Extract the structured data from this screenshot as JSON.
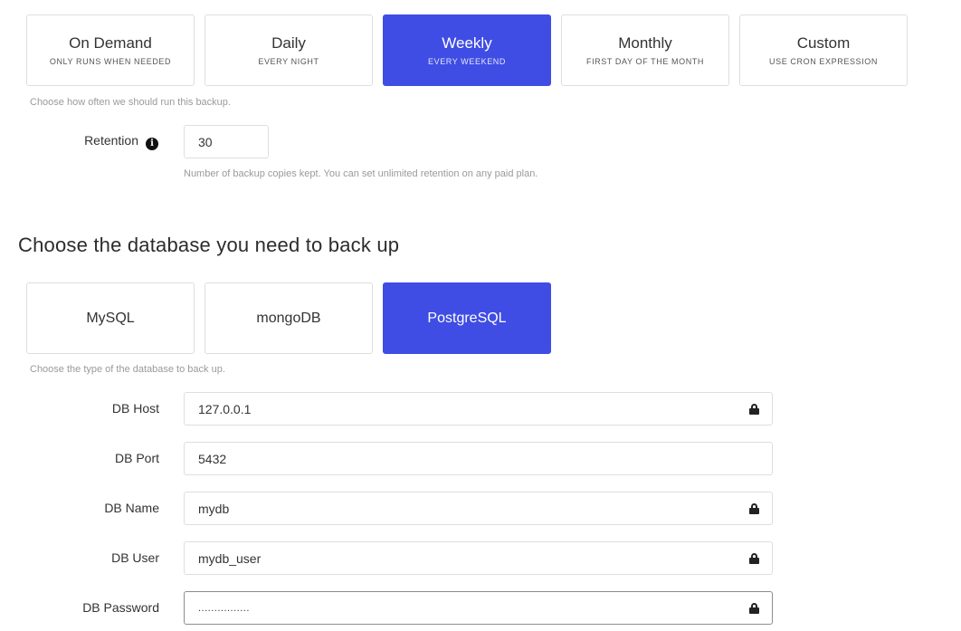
{
  "schedule": {
    "options": [
      {
        "title": "On Demand",
        "subtitle": "ONLY RUNS WHEN NEEDED",
        "selected": false
      },
      {
        "title": "Daily",
        "subtitle": "EVERY NIGHT",
        "selected": false
      },
      {
        "title": "Weekly",
        "subtitle": "EVERY WEEKEND",
        "selected": true
      },
      {
        "title": "Monthly",
        "subtitle": "FIRST DAY OF THE MONTH",
        "selected": false
      },
      {
        "title": "Custom",
        "subtitle": "USE CRON EXPRESSION",
        "selected": false
      }
    ],
    "hint": "Choose how often we should run this backup."
  },
  "retention": {
    "label": "Retention",
    "info_icon": "i",
    "value": "30",
    "hint": "Number of backup copies kept. You can set unlimited retention on any paid plan."
  },
  "database": {
    "heading": "Choose the database you need to back up",
    "options": [
      {
        "title": "MySQL",
        "selected": false
      },
      {
        "title": "mongoDB",
        "selected": false
      },
      {
        "title": "PostgreSQL",
        "selected": true
      }
    ],
    "hint": "Choose the type of the database to back up."
  },
  "connection": {
    "host": {
      "label": "DB Host",
      "value": "127.0.0.1",
      "icon": "lock-icon"
    },
    "port": {
      "label": "DB Port",
      "value": "5432"
    },
    "name": {
      "label": "DB Name",
      "value": "mydb",
      "icon": "lock-icon"
    },
    "user": {
      "label": "DB User",
      "value": "mydb_user",
      "icon": "lock-icon"
    },
    "password": {
      "label": "DB Password",
      "value": "................",
      "icon": "lock-icon"
    }
  },
  "colors": {
    "accent": "#3f4de4",
    "border": "#dedede",
    "hint_text": "#9a9a9a"
  }
}
